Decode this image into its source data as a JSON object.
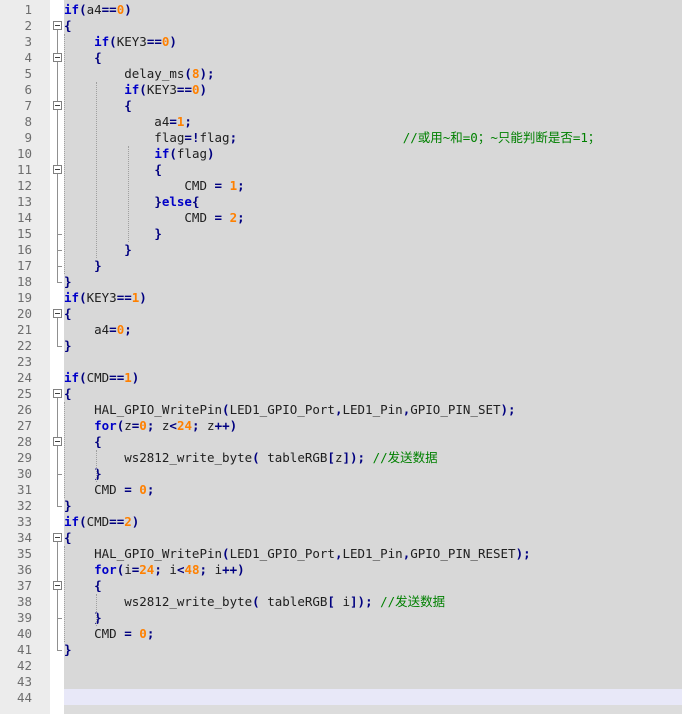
{
  "editor": {
    "lines": [
      {
        "n": "1",
        "t": [
          [
            "kw",
            "if"
          ],
          [
            "op",
            "("
          ],
          [
            "pl",
            "a4"
          ],
          [
            "op",
            "=="
          ],
          [
            "num",
            "0"
          ],
          [
            "op",
            ")"
          ]
        ]
      },
      {
        "n": "2",
        "t": [
          [
            "op",
            "{"
          ]
        ]
      },
      {
        "n": "3",
        "t": [
          [
            "pl",
            "    "
          ],
          [
            "kw",
            "if"
          ],
          [
            "op",
            "("
          ],
          [
            "pl",
            "KEY3"
          ],
          [
            "op",
            "=="
          ],
          [
            "num",
            "0"
          ],
          [
            "op",
            ")"
          ]
        ]
      },
      {
        "n": "4",
        "t": [
          [
            "pl",
            "    "
          ],
          [
            "op",
            "{"
          ]
        ]
      },
      {
        "n": "5",
        "t": [
          [
            "pl",
            "        delay_ms"
          ],
          [
            "op",
            "("
          ],
          [
            "num",
            "8"
          ],
          [
            "op",
            ");"
          ]
        ]
      },
      {
        "n": "6",
        "t": [
          [
            "pl",
            "        "
          ],
          [
            "kw",
            "if"
          ],
          [
            "op",
            "("
          ],
          [
            "pl",
            "KEY3"
          ],
          [
            "op",
            "=="
          ],
          [
            "num",
            "0"
          ],
          [
            "op",
            ")"
          ]
        ]
      },
      {
        "n": "7",
        "t": [
          [
            "pl",
            "        "
          ],
          [
            "op",
            "{"
          ]
        ]
      },
      {
        "n": "8",
        "t": [
          [
            "pl",
            "            a4"
          ],
          [
            "op",
            "="
          ],
          [
            "num",
            "1"
          ],
          [
            "op",
            ";"
          ]
        ]
      },
      {
        "n": "9",
        "t": [
          [
            "pl",
            "            flag"
          ],
          [
            "op",
            "=!"
          ],
          [
            "pl",
            "flag"
          ],
          [
            "op",
            ";"
          ],
          [
            "pl",
            "                      "
          ],
          [
            "cm",
            "//或用~和=0；~只能判断是否=1；"
          ]
        ]
      },
      {
        "n": "10",
        "t": [
          [
            "pl",
            "            "
          ],
          [
            "kw",
            "if"
          ],
          [
            "op",
            "("
          ],
          [
            "pl",
            "flag"
          ],
          [
            "op",
            ")"
          ]
        ]
      },
      {
        "n": "11",
        "t": [
          [
            "pl",
            "            "
          ],
          [
            "op",
            "{"
          ]
        ]
      },
      {
        "n": "12",
        "t": [
          [
            "pl",
            "                CMD "
          ],
          [
            "op",
            "="
          ],
          [
            "pl",
            " "
          ],
          [
            "num",
            "1"
          ],
          [
            "op",
            ";"
          ]
        ]
      },
      {
        "n": "13",
        "t": [
          [
            "pl",
            "            "
          ],
          [
            "op",
            "}"
          ],
          [
            "kw",
            "else"
          ],
          [
            "op",
            "{"
          ]
        ]
      },
      {
        "n": "14",
        "t": [
          [
            "pl",
            "                CMD "
          ],
          [
            "op",
            "="
          ],
          [
            "pl",
            " "
          ],
          [
            "num",
            "2"
          ],
          [
            "op",
            ";"
          ]
        ]
      },
      {
        "n": "15",
        "t": [
          [
            "pl",
            "            "
          ],
          [
            "op",
            "}"
          ]
        ]
      },
      {
        "n": "16",
        "t": [
          [
            "pl",
            "        "
          ],
          [
            "op",
            "}"
          ]
        ]
      },
      {
        "n": "17",
        "t": [
          [
            "pl",
            "    "
          ],
          [
            "op",
            "}"
          ]
        ]
      },
      {
        "n": "18",
        "t": [
          [
            "op",
            "}"
          ]
        ]
      },
      {
        "n": "19",
        "t": [
          [
            "kw",
            "if"
          ],
          [
            "op",
            "("
          ],
          [
            "pl",
            "KEY3"
          ],
          [
            "op",
            "=="
          ],
          [
            "num",
            "1"
          ],
          [
            "op",
            ")"
          ]
        ]
      },
      {
        "n": "20",
        "t": [
          [
            "op",
            "{"
          ]
        ]
      },
      {
        "n": "21",
        "t": [
          [
            "pl",
            "    a4"
          ],
          [
            "op",
            "="
          ],
          [
            "num",
            "0"
          ],
          [
            "op",
            ";"
          ]
        ]
      },
      {
        "n": "22",
        "t": [
          [
            "op",
            "}"
          ]
        ]
      },
      {
        "n": "23",
        "t": []
      },
      {
        "n": "24",
        "t": [
          [
            "kw",
            "if"
          ],
          [
            "op",
            "("
          ],
          [
            "pl",
            "CMD"
          ],
          [
            "op",
            "=="
          ],
          [
            "num",
            "1"
          ],
          [
            "op",
            ")"
          ]
        ]
      },
      {
        "n": "25",
        "t": [
          [
            "op",
            "{"
          ]
        ]
      },
      {
        "n": "26",
        "t": [
          [
            "pl",
            "    HAL_GPIO_WritePin"
          ],
          [
            "op",
            "("
          ],
          [
            "pl",
            "LED1_GPIO_Port"
          ],
          [
            "op",
            ","
          ],
          [
            "pl",
            "LED1_Pin"
          ],
          [
            "op",
            ","
          ],
          [
            "pl",
            "GPIO_PIN_SET"
          ],
          [
            "op",
            ");"
          ]
        ]
      },
      {
        "n": "27",
        "t": [
          [
            "pl",
            "    "
          ],
          [
            "kw",
            "for"
          ],
          [
            "op",
            "("
          ],
          [
            "pl",
            "z"
          ],
          [
            "op",
            "="
          ],
          [
            "num",
            "0"
          ],
          [
            "op",
            ";"
          ],
          [
            "pl",
            " z"
          ],
          [
            "op",
            "<"
          ],
          [
            "num",
            "24"
          ],
          [
            "op",
            ";"
          ],
          [
            "pl",
            " z"
          ],
          [
            "op",
            "++)"
          ]
        ]
      },
      {
        "n": "28",
        "t": [
          [
            "pl",
            "    "
          ],
          [
            "op",
            "{"
          ]
        ]
      },
      {
        "n": "29",
        "t": [
          [
            "pl",
            "        ws2812_write_byte"
          ],
          [
            "op",
            "("
          ],
          [
            "pl",
            " tableRGB"
          ],
          [
            "op",
            "["
          ],
          [
            "pl",
            "z"
          ],
          [
            "op",
            "]);"
          ],
          [
            "pl",
            " "
          ],
          [
            "cm",
            "//发送数据"
          ]
        ]
      },
      {
        "n": "30",
        "t": [
          [
            "pl",
            "    "
          ],
          [
            "op",
            "}"
          ]
        ]
      },
      {
        "n": "31",
        "t": [
          [
            "pl",
            "    CMD "
          ],
          [
            "op",
            "="
          ],
          [
            "pl",
            " "
          ],
          [
            "num",
            "0"
          ],
          [
            "op",
            ";"
          ]
        ]
      },
      {
        "n": "32",
        "t": [
          [
            "op",
            "}"
          ]
        ]
      },
      {
        "n": "33",
        "t": [
          [
            "kw",
            "if"
          ],
          [
            "op",
            "("
          ],
          [
            "pl",
            "CMD"
          ],
          [
            "op",
            "=="
          ],
          [
            "num",
            "2"
          ],
          [
            "op",
            ")"
          ]
        ]
      },
      {
        "n": "34",
        "t": [
          [
            "op",
            "{"
          ]
        ]
      },
      {
        "n": "35",
        "t": [
          [
            "pl",
            "    HAL_GPIO_WritePin"
          ],
          [
            "op",
            "("
          ],
          [
            "pl",
            "LED1_GPIO_Port"
          ],
          [
            "op",
            ","
          ],
          [
            "pl",
            "LED1_Pin"
          ],
          [
            "op",
            ","
          ],
          [
            "pl",
            "GPIO_PIN_RESET"
          ],
          [
            "op",
            ");"
          ]
        ]
      },
      {
        "n": "36",
        "t": [
          [
            "pl",
            "    "
          ],
          [
            "kw",
            "for"
          ],
          [
            "op",
            "("
          ],
          [
            "pl",
            "i"
          ],
          [
            "op",
            "="
          ],
          [
            "num",
            "24"
          ],
          [
            "op",
            ";"
          ],
          [
            "pl",
            " i"
          ],
          [
            "op",
            "<"
          ],
          [
            "num",
            "48"
          ],
          [
            "op",
            ";"
          ],
          [
            "pl",
            " i"
          ],
          [
            "op",
            "++)"
          ]
        ]
      },
      {
        "n": "37",
        "t": [
          [
            "pl",
            "    "
          ],
          [
            "op",
            "{"
          ]
        ]
      },
      {
        "n": "38",
        "t": [
          [
            "pl",
            "        ws2812_write_byte"
          ],
          [
            "op",
            "("
          ],
          [
            "pl",
            " tableRGB"
          ],
          [
            "op",
            "["
          ],
          [
            "pl",
            " i"
          ],
          [
            "op",
            "]);"
          ],
          [
            "pl",
            " "
          ],
          [
            "cm",
            "//发送数据"
          ]
        ]
      },
      {
        "n": "39",
        "t": [
          [
            "pl",
            "    "
          ],
          [
            "op",
            "}"
          ]
        ]
      },
      {
        "n": "40",
        "t": [
          [
            "pl",
            "    CMD "
          ],
          [
            "op",
            "="
          ],
          [
            "pl",
            " "
          ],
          [
            "num",
            "0"
          ],
          [
            "op",
            ";"
          ]
        ]
      },
      {
        "n": "41",
        "t": [
          [
            "op",
            "}"
          ]
        ]
      },
      {
        "n": "42",
        "t": []
      },
      {
        "n": "43",
        "t": []
      },
      {
        "n": "44",
        "t": []
      }
    ],
    "fold_boxes": [
      "2",
      "4",
      "7",
      "11",
      "20",
      "25",
      "28",
      "34",
      "37"
    ],
    "colors": {
      "keyword": "#0000c8",
      "number": "#ff8000",
      "operator": "#000080",
      "comment": "#008000",
      "gutter": "#ececec",
      "background": "#d8d8d8"
    }
  }
}
